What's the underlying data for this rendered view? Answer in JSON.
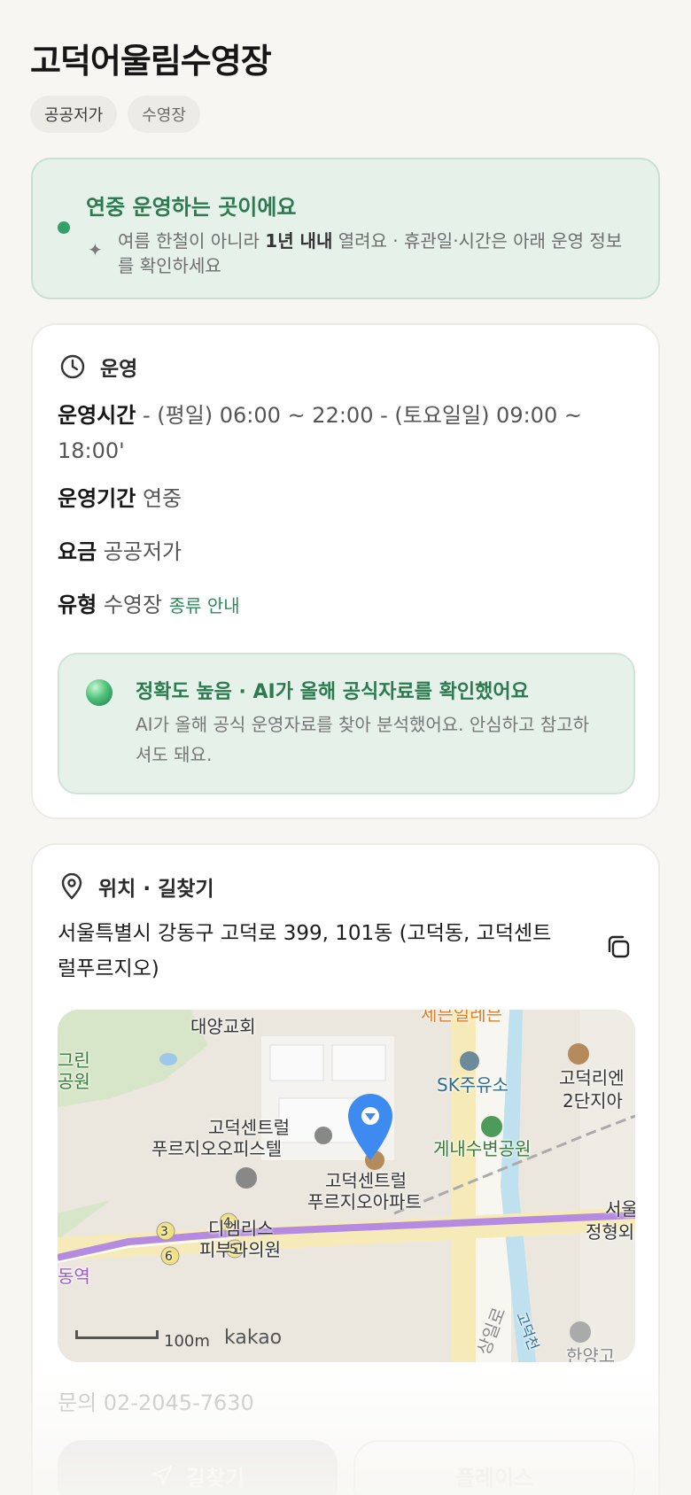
{
  "header": {
    "title": "고덕어울림수영장",
    "chips": [
      "공공저가",
      "수영장"
    ]
  },
  "banner": {
    "heading": "연중 운영하는 곳이에요",
    "desc_prefix": "여름 한철이 아니라 ",
    "desc_bold": "1년 내내",
    "desc_suffix": " 열려요 · 휴관일·시간은 아래 운영 정보를 확인하세요"
  },
  "operation": {
    "section_title": "운영",
    "hours_label": "운영시간",
    "hours_value": "- (평일) 06:00 ~ 22:00 - (토요일일) 09:00 ~ 18:00'",
    "period_label": "운영기간",
    "period_value": "연중",
    "fee_label": "요금",
    "fee_value": "공공저가",
    "type_label": "유형",
    "type_value": "수영장",
    "type_link": "종류 안내",
    "ai": {
      "heading": "정확도 높음 · AI가 올해 공식자료를 확인했어요",
      "desc": "AI가 올해 공식 운영자료를 찾아 분석했어요. 안심하고 참고하셔도 돼요."
    }
  },
  "location": {
    "section_title": "위치 · 길찾기",
    "address": "서울특별시 강동구 고덕로 399, 101동 (고덕동, 고덕센트럴푸르지오)",
    "map": {
      "labels": {
        "church": "대양교회",
        "seven": "세븐일레븐",
        "green_park_1": "그린",
        "green_park_2": "공원",
        "sk": "SK주유소",
        "godeok_ien_1": "고덕리엔",
        "godeok_ien_2": "2단지아",
        "office_1": "고덕센트럴",
        "office_2": "푸르지오오피스텔",
        "park": "게내수변공원",
        "apt_1": "고덕센트럴",
        "apt_2": "푸르지오아파트",
        "clinic_1": "디엠리스",
        "clinic_2": "피부과의원",
        "seoul_1": "서울",
        "seoul_2": "정형외",
        "station": "동역",
        "road": "상일로",
        "stream": "고덕천",
        "school": "한양고",
        "exit_3": "3",
        "exit_4": "4",
        "exit_5": "5",
        "exit_6": "6"
      },
      "scale": "100m",
      "brand": "kakao"
    },
    "contact": "문의 02-2045-7630",
    "route_button": "길찾기",
    "place_button": "플레이스"
  }
}
